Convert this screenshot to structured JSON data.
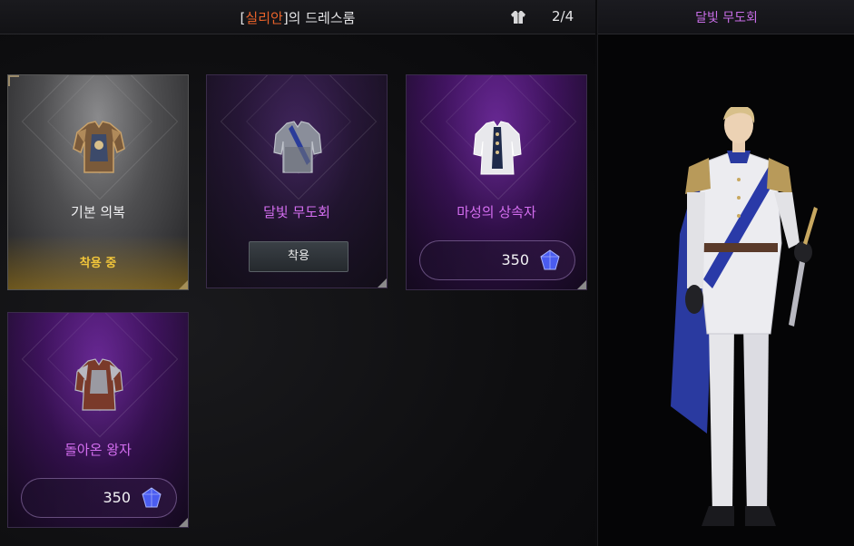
{
  "header": {
    "title_prefix": "[",
    "title_name": "실리안",
    "title_suffix": "]의 드레스룸",
    "count": "2/4",
    "count_icon": "outfit-icon"
  },
  "preview": {
    "title": "달빛 무도회"
  },
  "cards": [
    {
      "name": "기본 의복",
      "status": "착용 중"
    },
    {
      "name": "달빛 무도회",
      "button": "착용"
    },
    {
      "name": "마성의 상속자",
      "price": "350"
    },
    {
      "name": "돌아온 왕자",
      "price": "350"
    }
  ],
  "colors": {
    "accent_name": "#e8622a",
    "card_name_purple": "#d46ef0",
    "equipped": "#f2c63a",
    "preview_title": "#c96ee8"
  }
}
